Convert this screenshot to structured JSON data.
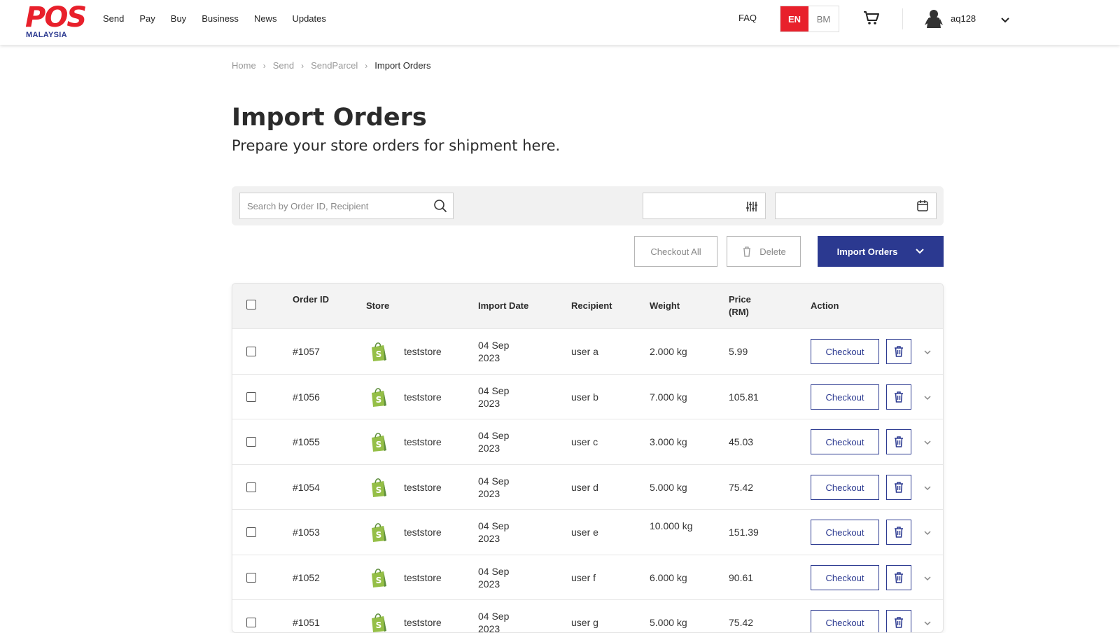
{
  "brand": {
    "logo_main": "POS",
    "logo_sub": "MALAYSIA",
    "primary_color": "#2b3990",
    "accent_color": "#e8202b"
  },
  "nav": [
    "Send",
    "Pay",
    "Buy",
    "Business",
    "News",
    "Updates"
  ],
  "header": {
    "faq": "FAQ",
    "lang_en": "EN",
    "lang_bm": "BM",
    "username": "aq128"
  },
  "breadcrumb": [
    "Home",
    "Send",
    "SendParcel",
    "Import Orders"
  ],
  "page": {
    "title": "Import Orders",
    "subtitle": "Prepare your store orders for shipment here."
  },
  "search": {
    "placeholder": "Search by Order ID, Recipient",
    "value": ""
  },
  "actions": {
    "checkout_all": "Checkout All",
    "delete": "Delete",
    "import_orders": "Import Orders"
  },
  "table": {
    "headers": {
      "order_id": "Order ID",
      "store": "Store",
      "import_date": "Import Date",
      "recipient": "Recipient",
      "weight": "Weight",
      "price": "Price (RM)",
      "action": "Action"
    },
    "checkout_label": "Checkout",
    "rows": [
      {
        "order_id": "#1057",
        "store": "teststore",
        "date_line1": "04 Sep",
        "date_line2": "2023",
        "recipient": "user a",
        "weight": "2.000 kg",
        "price": "5.99"
      },
      {
        "order_id": "#1056",
        "store": "teststore",
        "date_line1": "04 Sep",
        "date_line2": "2023",
        "recipient": "user b",
        "weight": "7.000 kg",
        "price": "105.81"
      },
      {
        "order_id": "#1055",
        "store": "teststore",
        "date_line1": "04 Sep",
        "date_line2": "2023",
        "recipient": "user c",
        "weight": "3.000 kg",
        "price": "45.03"
      },
      {
        "order_id": "#1054",
        "store": "teststore",
        "date_line1": "04 Sep",
        "date_line2": "2023",
        "recipient": "user d",
        "weight": "5.000 kg",
        "price": "75.42"
      },
      {
        "order_id": "#1053",
        "store": "teststore",
        "date_line1": "04 Sep",
        "date_line2": "2023",
        "recipient": "user e",
        "weight": "10.000 kg",
        "price": "151.39"
      },
      {
        "order_id": "#1052",
        "store": "teststore",
        "date_line1": "04 Sep",
        "date_line2": "2023",
        "recipient": "user f",
        "weight": "6.000 kg",
        "price": "90.61"
      },
      {
        "order_id": "#1051",
        "store": "teststore",
        "date_line1": "04 Sep",
        "date_line2": "2023",
        "recipient": "user g",
        "weight": "5.000 kg",
        "price": "75.42"
      }
    ]
  },
  "icons": {
    "search": "search-icon",
    "filter": "sliders-icon",
    "calendar": "calendar-icon",
    "cart": "cart-icon",
    "trash": "trash-icon",
    "chevron": "chevron-down-icon",
    "store": "shopify-bag-icon"
  }
}
